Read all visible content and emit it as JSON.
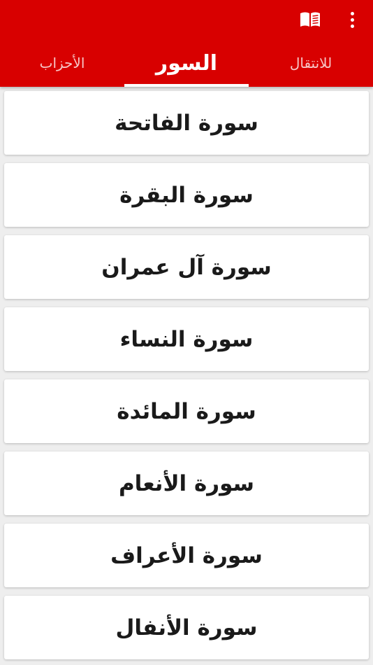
{
  "header": {
    "icons": {
      "menu": "overflow-menu-icon",
      "book": "open-book-icon"
    },
    "colors": {
      "bar": "#d80000",
      "text": "#ffffff"
    }
  },
  "tabs": [
    {
      "label": "للانتقال",
      "active": false
    },
    {
      "label": "السور",
      "active": true
    },
    {
      "label": "الأحزاب",
      "active": false
    }
  ],
  "surahs": [
    {
      "label": "سورة الفاتحة"
    },
    {
      "label": "سورة البقرة"
    },
    {
      "label": "سورة آل عمران"
    },
    {
      "label": "سورة النساء"
    },
    {
      "label": "سورة المائدة"
    },
    {
      "label": "سورة الأنعام"
    },
    {
      "label": "سورة الأعراف"
    },
    {
      "label": "سورة الأنفال"
    }
  ]
}
